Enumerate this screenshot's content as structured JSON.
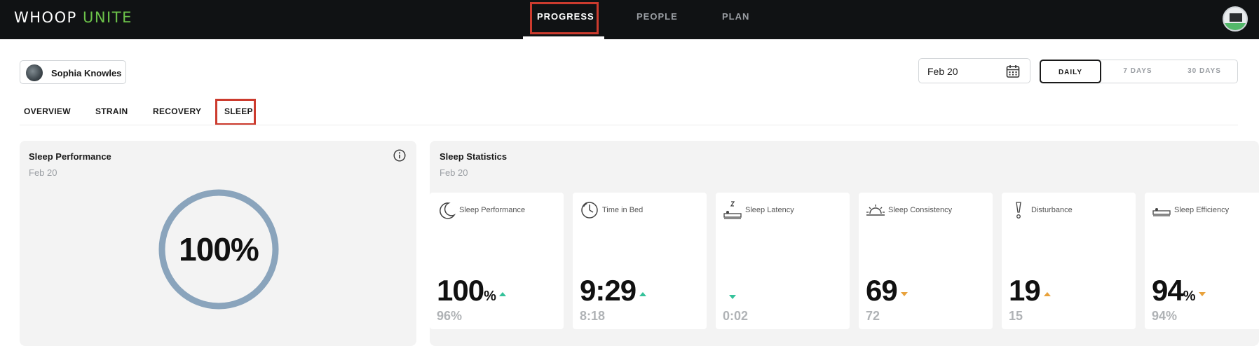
{
  "app": {
    "logo_main": "WHOOP",
    "logo_accent": "UNITE"
  },
  "nav": {
    "items": [
      "PROGRESS",
      "PEOPLE",
      "PLAN"
    ],
    "active": "PROGRESS"
  },
  "user": {
    "name": "Sophia Knowles"
  },
  "date_picker": {
    "value": "Feb 20"
  },
  "range": {
    "options": [
      "DAILY",
      "7 DAYS",
      "30 DAYS"
    ],
    "selected": "DAILY"
  },
  "tabs": {
    "items": [
      "OVERVIEW",
      "STRAIN",
      "RECOVERY",
      "SLEEP"
    ],
    "active": "SLEEP"
  },
  "performance_card": {
    "title": "Sleep Performance",
    "date": "Feb 20",
    "value": "100%",
    "ring_fraction": 1.0,
    "ring_color": "#8aa4bc"
  },
  "stats_card": {
    "title": "Sleep Statistics",
    "date": "Feb 20",
    "tiles": [
      {
        "icon": "moon-icon",
        "label": "Sleep Performance",
        "value": "100",
        "unit": "%",
        "trend": "up",
        "trend_color": "#34c29a",
        "baseline": "96%"
      },
      {
        "icon": "clock-bed-icon",
        "label": "Time in Bed",
        "value": "9:29",
        "unit": "",
        "trend": "up",
        "trend_color": "#34c29a",
        "baseline": "8:18"
      },
      {
        "icon": "sleep-latency-icon",
        "label": "Sleep Latency",
        "value": "",
        "unit": "",
        "trend": "down",
        "trend_color": "#34c29a",
        "baseline": "0:02"
      },
      {
        "icon": "sunrise-icon",
        "label": "Sleep Consistency",
        "value": "69",
        "unit": "",
        "trend": "down",
        "trend_color": "#e8a23c",
        "baseline": "72"
      },
      {
        "icon": "exclamation-icon",
        "label": "Disturbance",
        "value": "19",
        "unit": "",
        "trend": "up",
        "trend_color": "#e8a23c",
        "baseline": "15"
      },
      {
        "icon": "bed-icon",
        "label": "Sleep Efficiency",
        "value": "94",
        "unit": "%",
        "trend": "down",
        "trend_color": "#e8a23c",
        "baseline": "94%"
      }
    ]
  }
}
